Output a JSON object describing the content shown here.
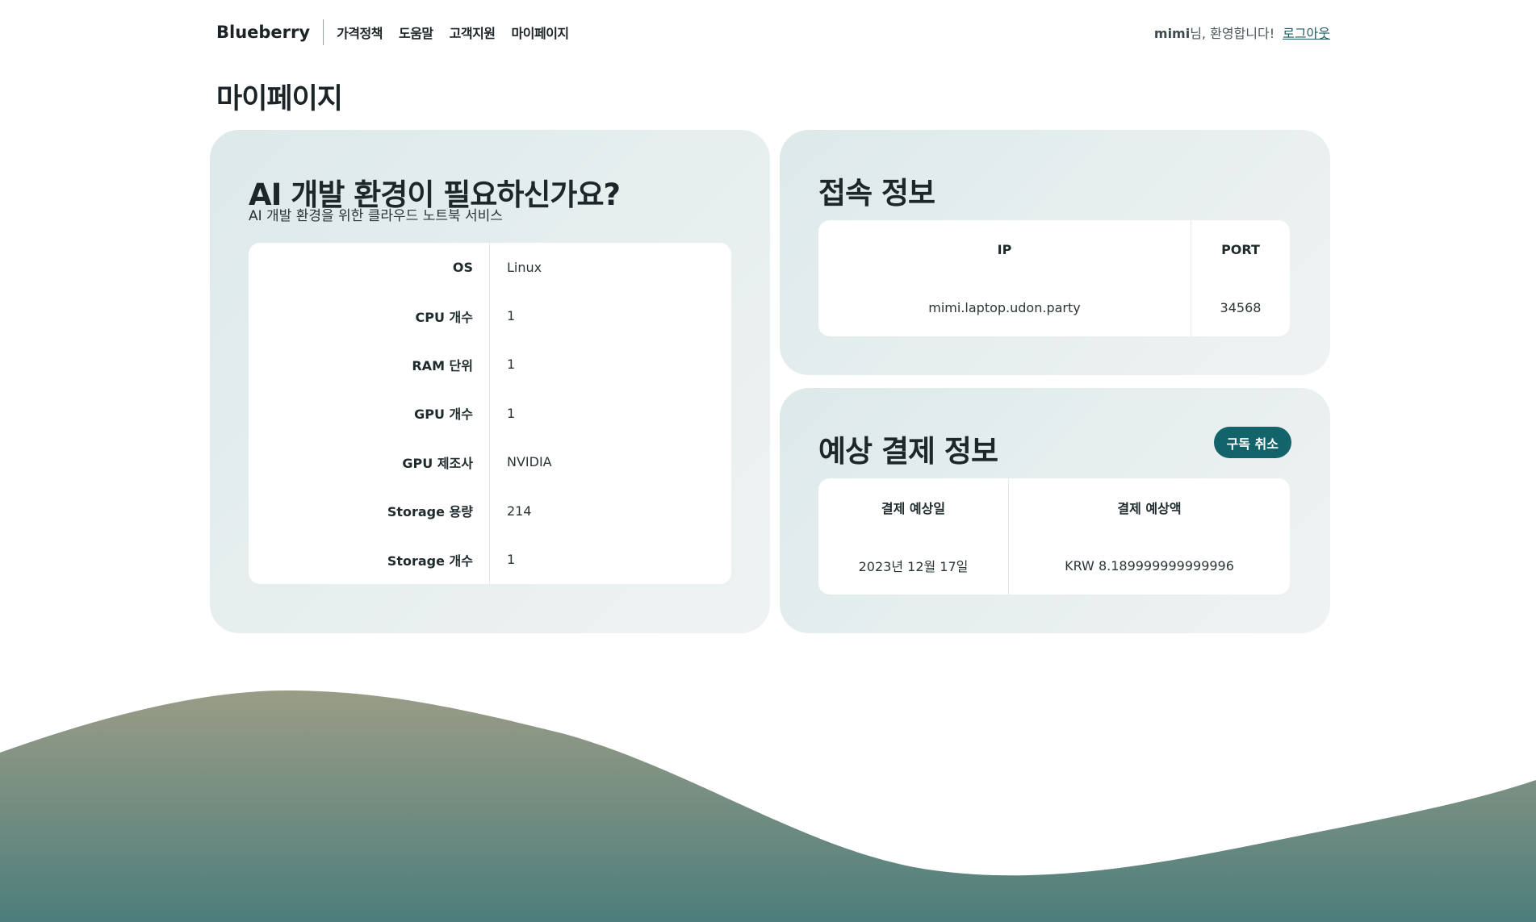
{
  "header": {
    "brand": "Blueberry",
    "nav": [
      "가격정책",
      "도움말",
      "고객지원",
      "마이페이지"
    ],
    "user": "mimi",
    "welcome_suffix": "님, 환영합니다!",
    "logout": "로그아웃"
  },
  "page_title": "마이페이지",
  "ai_card": {
    "title": "AI 개발 환경이 필요하신가요?",
    "subtitle": "AI 개발 환경을 위한 클라우드 노트북 서비스",
    "specs": [
      {
        "label": "OS",
        "value": "Linux"
      },
      {
        "label": "CPU 개수",
        "value": "1"
      },
      {
        "label": "RAM 단위",
        "value": "1"
      },
      {
        "label": "GPU 개수",
        "value": "1"
      },
      {
        "label": "GPU 제조사",
        "value": "NVIDIA"
      },
      {
        "label": "Storage 용량",
        "value": "214"
      },
      {
        "label": "Storage 개수",
        "value": "1"
      }
    ]
  },
  "connection": {
    "title": "접속 정보",
    "ip_header": "IP",
    "port_header": "PORT",
    "ip": "mimi.laptop.udon.party",
    "port": "34568"
  },
  "payment": {
    "title": "예상 결제 정보",
    "cancel": "구독 취소",
    "date_header": "결제 예상일",
    "amount_header": "결제 예상액",
    "date": "2023년 12월 17일",
    "amount": "KRW 8.189999999999996"
  },
  "colors": {
    "accent": "#13636a",
    "wave_top": "#9a9c86",
    "wave_bottom": "#4d7e7c"
  }
}
